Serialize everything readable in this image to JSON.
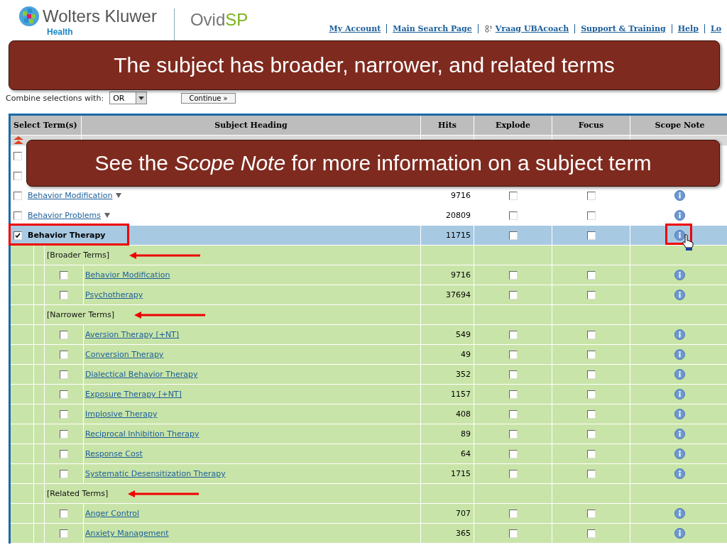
{
  "header": {
    "brand": "Wolters Kluwer",
    "brand_sub": "Health",
    "product": "Ovid",
    "product_suffix": "SP",
    "nav": [
      {
        "label": "My Account",
        "kind": "link"
      },
      {
        "label": "Main Search Page",
        "kind": "link"
      },
      {
        "label": "Vraag UBAcoach",
        "kind": "coach"
      },
      {
        "label": "Support & Training",
        "kind": "link"
      },
      {
        "label": "Help",
        "kind": "link"
      },
      {
        "label": "Lo",
        "kind": "link"
      }
    ]
  },
  "combine": {
    "label": "Combine selections with:",
    "value": "OR",
    "button": "Continue »"
  },
  "callouts": [
    {
      "text": "The subject has broader, narrower, and related terms"
    },
    {
      "text": "See the *Scope Note* for more information on a subject term"
    }
  ],
  "table": {
    "columns": [
      "Select Term(s)",
      "Subject Heading",
      "Hits",
      "Explode",
      "Focus",
      "Scope Note"
    ],
    "covered_rows": [
      {
        "checked": false
      },
      {
        "checked": false
      }
    ],
    "rows": [
      {
        "term": "Behavior Modification",
        "hits": "9716",
        "checked": false,
        "explode": false,
        "focus": false,
        "selected": false,
        "highlighted": false,
        "expanded": false
      },
      {
        "term": "Behavior Problems",
        "hits": "20809",
        "checked": false,
        "explode": false,
        "focus": false,
        "selected": false,
        "highlighted": false,
        "expanded": false
      },
      {
        "term": "Behavior Therapy",
        "hits": "11715",
        "checked": true,
        "explode": false,
        "focus": false,
        "selected": true,
        "highlighted": true,
        "expanded": true,
        "scope_highlighted": true,
        "groups": [
          {
            "label": "[Broader Terms]",
            "arrow": true,
            "children": [
              {
                "term": "Behavior Modification",
                "hits": "9716",
                "checked": false,
                "explode": false,
                "focus": false
              },
              {
                "term": "Psychotherapy",
                "hits": "37694",
                "checked": false,
                "explode": false,
                "focus": false
              }
            ]
          },
          {
            "label": "[Narrower Terms]",
            "arrow": true,
            "children": [
              {
                "term": "Aversion Therapy [+NT]",
                "hits": "549",
                "checked": false,
                "explode": false,
                "focus": false
              },
              {
                "term": "Conversion Therapy",
                "hits": "49",
                "checked": false,
                "explode": false,
                "focus": false
              },
              {
                "term": "Dialectical Behavior Therapy",
                "hits": "352",
                "checked": false,
                "explode": false,
                "focus": false
              },
              {
                "term": "Exposure Therapy [+NT]",
                "hits": "1157",
                "checked": false,
                "explode": false,
                "focus": false
              },
              {
                "term": "Implosive Therapy",
                "hits": "408",
                "checked": false,
                "explode": false,
                "focus": false
              },
              {
                "term": "Reciprocal Inhibition Therapy",
                "hits": "89",
                "checked": false,
                "explode": false,
                "focus": false
              },
              {
                "term": "Response Cost",
                "hits": "64",
                "checked": false,
                "explode": false,
                "focus": false
              },
              {
                "term": "Systematic Desensitization Therapy",
                "hits": "1715",
                "checked": false,
                "explode": false,
                "focus": false
              }
            ]
          },
          {
            "label": "[Related Terms]",
            "arrow": true,
            "children": [
              {
                "term": "Anger Control",
                "hits": "707",
                "checked": false,
                "explode": false,
                "focus": false
              },
              {
                "term": "Anxiety Management",
                "hits": "365",
                "checked": false,
                "explode": false,
                "focus": false
              }
            ]
          }
        ]
      }
    ]
  }
}
